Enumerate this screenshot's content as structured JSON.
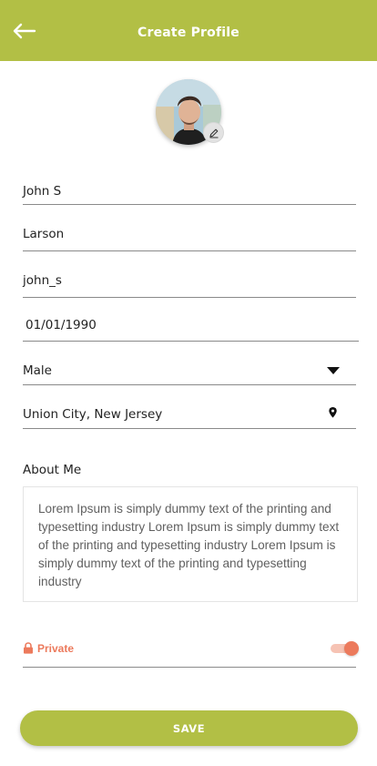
{
  "colors": {
    "primary": "#b2bf45",
    "accent": "#ec7a5c",
    "text": "#222222",
    "muted_text": "#606060"
  },
  "header": {
    "title": "Create Profile",
    "back_icon": "arrow-left-icon"
  },
  "avatar": {
    "edit_icon": "pencil-icon"
  },
  "form": {
    "first_name": "John S",
    "last_name": "Larson",
    "username": "john_s",
    "date_of_birth": "01/01/1990",
    "gender": "Male",
    "gender_icon": "caret-down-icon",
    "location": "Union City, New Jersey",
    "location_icon": "map-pin-icon",
    "about_label": "About Me",
    "about_text": "Lorem Ipsum is simply dummy text of the printing and typesetting industry Lorem Ipsum is simply dummy text of the printing and typesetting industry Lorem Ipsum is simply dummy text of the printing and typesetting industry"
  },
  "privacy": {
    "label": "Private",
    "icon": "lock-icon",
    "enabled": true
  },
  "actions": {
    "save_label": "SAVE"
  }
}
